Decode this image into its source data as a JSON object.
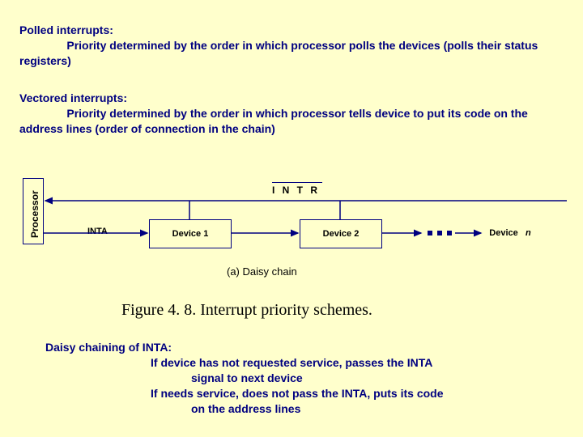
{
  "polled": {
    "title": "Polled interrupts:",
    "body": "Priority determined by the order in which processor polls the devices (polls their status registers)"
  },
  "vectored": {
    "title": "Vectored interrupts:",
    "body": "Priority determined by the order in which processor tells device to put its code on the address lines (order of connection in the chain)"
  },
  "diagram": {
    "processor": "Processor",
    "intr": "I N T R",
    "inta": "INTA",
    "device1": "Device 1",
    "device2": "Device 2",
    "deviceN_label": "Device",
    "deviceN_n": "n",
    "caption": "(a) Daisy chain"
  },
  "figure_title": "Figure 4. 8. Interrupt priority schemes.",
  "daisy": {
    "title": "Daisy chaining of INTA:",
    "line1": "If device has not requested service, passes the INTA",
    "line2": "signal to next device",
    "line3": "If needs service, does not pass the INTA, puts its code",
    "line4": "on the address lines"
  },
  "colors": {
    "ink": "#000080",
    "bg": "#ffffcc"
  }
}
